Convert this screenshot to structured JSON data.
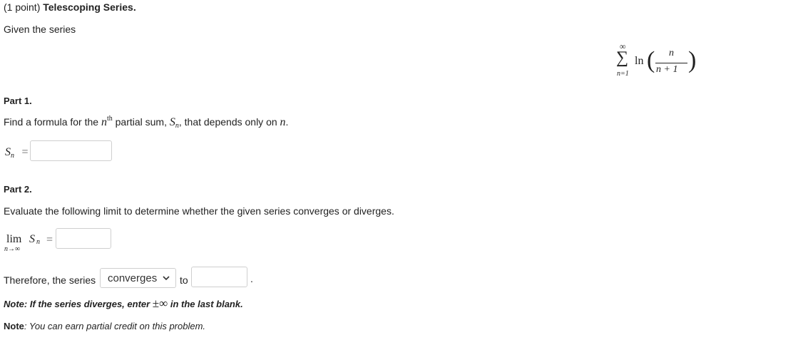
{
  "header": {
    "points": "(1 point)",
    "title": "Telescoping Series."
  },
  "intro": "Given the series",
  "series": {
    "sum_symbol": "∑",
    "upper": "∞",
    "lower": "n=1",
    "func": "ln",
    "numerator": "n",
    "denominator": "n + 1"
  },
  "part1": {
    "heading": "Part 1.",
    "text_before": "Find a formula for the ",
    "n": "n",
    "th": "th",
    "text_mid": " partial sum, ",
    "S": "S",
    "sub_n": "n",
    "text_after": ", that depends only on ",
    "n_end": "n",
    "period": ".",
    "equation_lhs_S": "S",
    "equation_lhs_n": "n",
    "equals": "="
  },
  "part2": {
    "heading": "Part 2.",
    "instruction": "Evaluate the following limit to determine whether the given series converges or diverges.",
    "lim": "lim",
    "lim_sub": "n→∞",
    "S": "S",
    "sub_n": "n",
    "equals": "=",
    "therefore": "Therefore, the series",
    "select_value": "converges",
    "to": "to",
    "period": "."
  },
  "note1": {
    "text_before": "Note: If the series diverges, enter ",
    "symbol": "±∞",
    "text_after": " in the last blank."
  },
  "note2": {
    "label": "Note",
    "text": ": You can earn partial credit on this problem."
  }
}
